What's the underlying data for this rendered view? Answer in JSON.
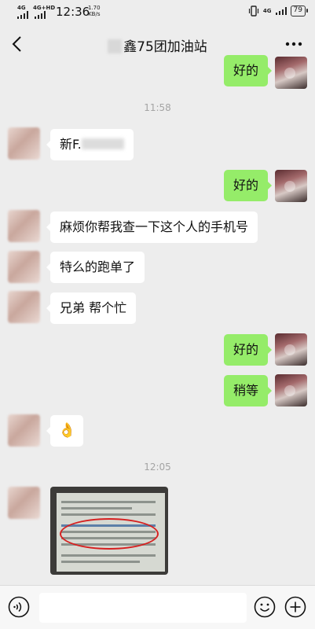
{
  "status_bar": {
    "network_1": "4G",
    "network_2": "4G+HD",
    "time": "12:36",
    "speed_value": "1.70",
    "speed_unit": "KB/s",
    "right_network": "4G",
    "battery": "79"
  },
  "header": {
    "title": "鑫75团加油站",
    "back_icon": "chevron-left-icon",
    "more_icon": "more-dots-icon"
  },
  "messages": {
    "m1": "好的",
    "t1": "11:58",
    "m2_prefix": "新F.",
    "m3": "好的",
    "m4": "麻烦你帮我查一下这个人的手机号",
    "m5": "特么的跑单了",
    "m6": "兄弟 帮个忙",
    "m7": "好的",
    "m8": "稍等",
    "m9_emoji": "👌",
    "t2": "12:05"
  },
  "input_bar": {
    "voice_icon": "voice-icon",
    "emoji_icon": "emoji-icon",
    "plus_icon": "plus-icon",
    "text_value": ""
  },
  "colors": {
    "background": "#ededed",
    "outgoing_bubble": "#95ec69",
    "incoming_bubble": "#ffffff",
    "photo_annotation": "#d62020"
  }
}
